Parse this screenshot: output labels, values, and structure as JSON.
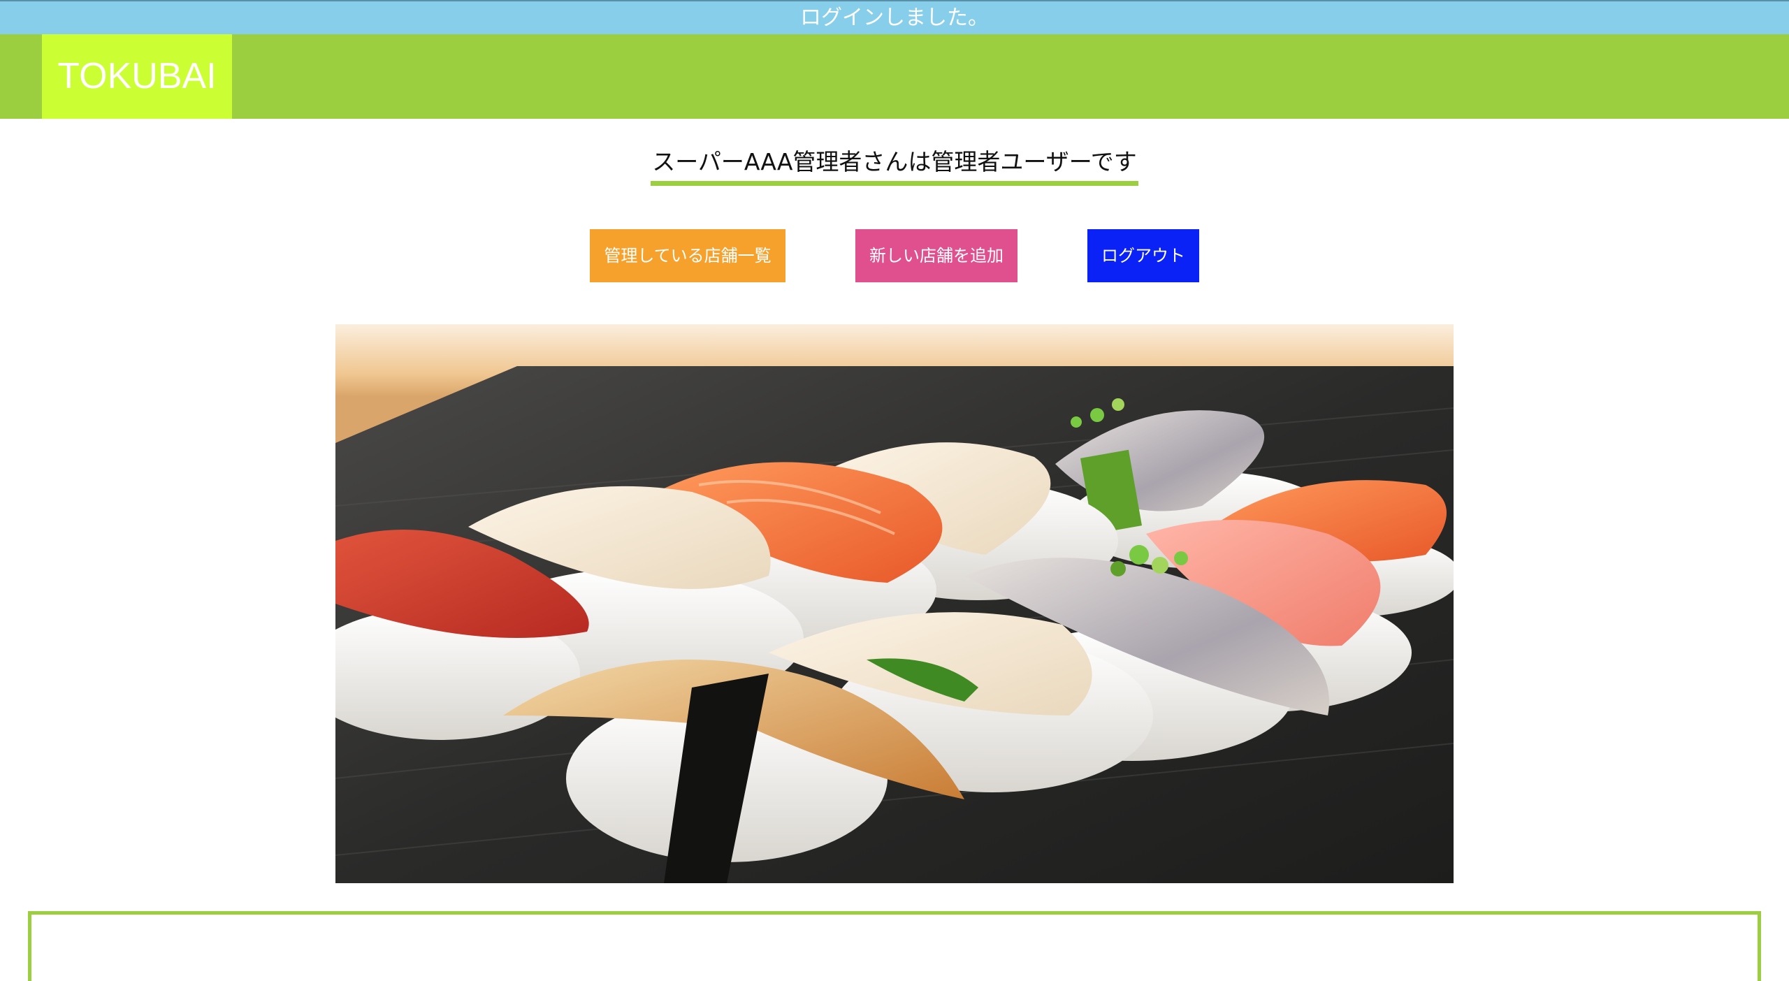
{
  "flash": {
    "message": "ログインしました。"
  },
  "header": {
    "logo": "TOKUBAI"
  },
  "main": {
    "title": "スーパーAAA管理者さんは管理者ユーザーです",
    "buttons": {
      "stores_label": "管理している店舗一覧",
      "add_store_label": "新しい店舗を追加",
      "logout_label": "ログアウト"
    },
    "hero_image": {
      "subject": "nigiri sushi assortment on dark wooden board"
    }
  },
  "colors": {
    "flash_bg": "#87ceeb",
    "header_bg": "#9ccf3f",
    "logo_bg": "#ccff33",
    "stores_btn": "#f6a12c",
    "add_btn": "#e0508e",
    "logout_btn": "#0a22f5"
  }
}
